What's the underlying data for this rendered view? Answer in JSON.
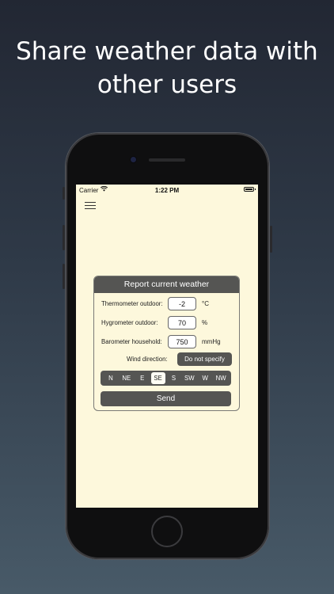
{
  "headline": {
    "line1": "Share weather data with",
    "line2": "other users"
  },
  "status_bar": {
    "carrier": "Carrier",
    "time": "1:22 PM"
  },
  "card": {
    "title": "Report current weather",
    "thermometer": {
      "label": "Thermometer outdoor:",
      "value": "-2",
      "unit": "°C"
    },
    "hygrometer": {
      "label": "Hygrometer outdoor:",
      "value": "70",
      "unit": "%"
    },
    "barometer": {
      "label": "Barometer household:",
      "value": "750",
      "unit": "mmHg"
    },
    "wind": {
      "label": "Wind direction:",
      "selected_option": "Do not specify"
    },
    "directions": [
      "N",
      "NE",
      "E",
      "SE",
      "S",
      "SW",
      "W",
      "NW"
    ],
    "selected_direction": "SE",
    "send_label": "Send"
  },
  "colors": {
    "screen_bg": "#fdf8dc",
    "control_bg": "#555553",
    "accent_text": "#ffffff"
  }
}
